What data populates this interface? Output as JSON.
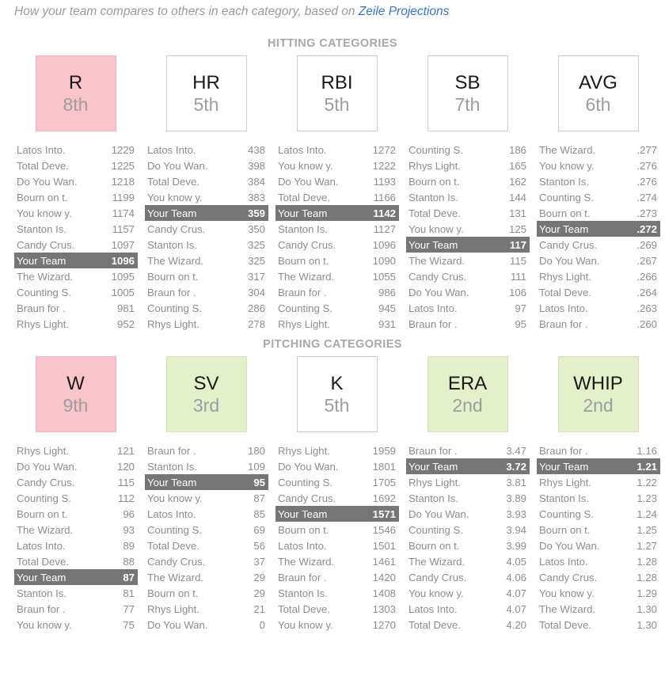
{
  "intro": {
    "text_before": "How your team compares to others in each category, based on ",
    "link_text": "Zeile Projections"
  },
  "colors": {
    "highlight_row": "#767676",
    "bad_box": "#fbc3ca",
    "good_box": "#e3f0c9",
    "link": "#3b73c4",
    "muted_text": "#8d8d8d"
  },
  "sections": [
    {
      "title": "HITTING CATEGORIES",
      "columns": [
        {
          "abbr": "R",
          "rank": "8th",
          "style": "pink",
          "rows": [
            {
              "team": "Latos Into.",
              "value": "1229",
              "me": false
            },
            {
              "team": "Total Deve.",
              "value": "1225",
              "me": false
            },
            {
              "team": "Do You Wan.",
              "value": "1218",
              "me": false
            },
            {
              "team": "Bourn on t.",
              "value": "1199",
              "me": false
            },
            {
              "team": "You know y.",
              "value": "1174",
              "me": false
            },
            {
              "team": "Stanton Is.",
              "value": "1157",
              "me": false
            },
            {
              "team": "Candy Crus.",
              "value": "1097",
              "me": false
            },
            {
              "team": "Your Team",
              "value": "1096",
              "me": true
            },
            {
              "team": "The Wizard.",
              "value": "1095",
              "me": false
            },
            {
              "team": "Counting S.",
              "value": "1005",
              "me": false
            },
            {
              "team": "Braun for .",
              "value": "981",
              "me": false
            },
            {
              "team": "Rhys Light.",
              "value": "952",
              "me": false
            }
          ]
        },
        {
          "abbr": "HR",
          "rank": "5th",
          "style": "plain",
          "rows": [
            {
              "team": "Latos Into.",
              "value": "438",
              "me": false
            },
            {
              "team": "Do You Wan.",
              "value": "398",
              "me": false
            },
            {
              "team": "Total Deve.",
              "value": "384",
              "me": false
            },
            {
              "team": "You know y.",
              "value": "383",
              "me": false
            },
            {
              "team": "Your Team",
              "value": "359",
              "me": true
            },
            {
              "team": "Candy Crus.",
              "value": "350",
              "me": false
            },
            {
              "team": "Stanton Is.",
              "value": "325",
              "me": false
            },
            {
              "team": "The Wizard.",
              "value": "325",
              "me": false
            },
            {
              "team": "Bourn on t.",
              "value": "317",
              "me": false
            },
            {
              "team": "Braun for .",
              "value": "304",
              "me": false
            },
            {
              "team": "Counting S.",
              "value": "286",
              "me": false
            },
            {
              "team": "Rhys Light.",
              "value": "278",
              "me": false
            }
          ]
        },
        {
          "abbr": "RBI",
          "rank": "5th",
          "style": "plain",
          "rows": [
            {
              "team": "Latos Into.",
              "value": "1272",
              "me": false
            },
            {
              "team": "You know y.",
              "value": "1222",
              "me": false
            },
            {
              "team": "Do You Wan.",
              "value": "1193",
              "me": false
            },
            {
              "team": "Total Deve.",
              "value": "1166",
              "me": false
            },
            {
              "team": "Your Team",
              "value": "1142",
              "me": true
            },
            {
              "team": "Stanton Is.",
              "value": "1127",
              "me": false
            },
            {
              "team": "Candy Crus.",
              "value": "1096",
              "me": false
            },
            {
              "team": "Bourn on t.",
              "value": "1090",
              "me": false
            },
            {
              "team": "The Wizard.",
              "value": "1055",
              "me": false
            },
            {
              "team": "Braun for .",
              "value": "986",
              "me": false
            },
            {
              "team": "Counting S.",
              "value": "945",
              "me": false
            },
            {
              "team": "Rhys Light.",
              "value": "931",
              "me": false
            }
          ]
        },
        {
          "abbr": "SB",
          "rank": "7th",
          "style": "plain",
          "rows": [
            {
              "team": "Counting S.",
              "value": "186",
              "me": false
            },
            {
              "team": "Rhys Light.",
              "value": "165",
              "me": false
            },
            {
              "team": "Bourn on t.",
              "value": "162",
              "me": false
            },
            {
              "team": "Stanton Is.",
              "value": "144",
              "me": false
            },
            {
              "team": "Total Deve.",
              "value": "131",
              "me": false
            },
            {
              "team": "You know y.",
              "value": "125",
              "me": false
            },
            {
              "team": "Your Team",
              "value": "117",
              "me": true
            },
            {
              "team": "The Wizard.",
              "value": "115",
              "me": false
            },
            {
              "team": "Candy Crus.",
              "value": "111",
              "me": false
            },
            {
              "team": "Do You Wan.",
              "value": "106",
              "me": false
            },
            {
              "team": "Latos Into.",
              "value": "97",
              "me": false
            },
            {
              "team": "Braun for .",
              "value": "95",
              "me": false
            }
          ]
        },
        {
          "abbr": "AVG",
          "rank": "6th",
          "style": "plain",
          "rows": [
            {
              "team": "The Wizard.",
              "value": ".277",
              "me": false
            },
            {
              "team": "You know y.",
              "value": ".276",
              "me": false
            },
            {
              "team": "Stanton Is.",
              "value": ".276",
              "me": false
            },
            {
              "team": "Counting S.",
              "value": ".274",
              "me": false
            },
            {
              "team": "Bourn on t.",
              "value": ".273",
              "me": false
            },
            {
              "team": "Your Team",
              "value": ".272",
              "me": true
            },
            {
              "team": "Candy Crus.",
              "value": ".269",
              "me": false
            },
            {
              "team": "Do You Wan.",
              "value": ".267",
              "me": false
            },
            {
              "team": "Rhys Light.",
              "value": ".266",
              "me": false
            },
            {
              "team": "Total Deve.",
              "value": ".264",
              "me": false
            },
            {
              "team": "Latos Into.",
              "value": ".263",
              "me": false
            },
            {
              "team": "Braun for .",
              "value": ".260",
              "me": false
            }
          ]
        }
      ]
    },
    {
      "title": "PITCHING CATEGORIES",
      "columns": [
        {
          "abbr": "W",
          "rank": "9th",
          "style": "pink",
          "rows": [
            {
              "team": "Rhys Light.",
              "value": "121",
              "me": false
            },
            {
              "team": "Do You Wan.",
              "value": "120",
              "me": false
            },
            {
              "team": "Candy Crus.",
              "value": "115",
              "me": false
            },
            {
              "team": "Counting S.",
              "value": "112",
              "me": false
            },
            {
              "team": "Bourn on t.",
              "value": "96",
              "me": false
            },
            {
              "team": "The Wizard.",
              "value": "93",
              "me": false
            },
            {
              "team": "Latos Into.",
              "value": "89",
              "me": false
            },
            {
              "team": "Total Deve.",
              "value": "88",
              "me": false
            },
            {
              "team": "Your Team",
              "value": "87",
              "me": true
            },
            {
              "team": "Stanton Is.",
              "value": "81",
              "me": false
            },
            {
              "team": "Braun for .",
              "value": "77",
              "me": false
            },
            {
              "team": "You know y.",
              "value": "75",
              "me": false
            }
          ]
        },
        {
          "abbr": "SV",
          "rank": "3rd",
          "style": "green",
          "rows": [
            {
              "team": "Braun for .",
              "value": "180",
              "me": false
            },
            {
              "team": "Stanton Is.",
              "value": "109",
              "me": false
            },
            {
              "team": "Your Team",
              "value": "95",
              "me": true
            },
            {
              "team": "You know y.",
              "value": "87",
              "me": false
            },
            {
              "team": "Latos Into.",
              "value": "85",
              "me": false
            },
            {
              "team": "Counting S.",
              "value": "69",
              "me": false
            },
            {
              "team": "Total Deve.",
              "value": "56",
              "me": false
            },
            {
              "team": "Candy Crus.",
              "value": "37",
              "me": false
            },
            {
              "team": "The Wizard.",
              "value": "29",
              "me": false
            },
            {
              "team": "Bourn on t.",
              "value": "29",
              "me": false
            },
            {
              "team": "Rhys Light.",
              "value": "21",
              "me": false
            },
            {
              "team": "Do You Wan.",
              "value": "0",
              "me": false
            }
          ]
        },
        {
          "abbr": "K",
          "rank": "5th",
          "style": "plain",
          "rows": [
            {
              "team": "Rhys Light.",
              "value": "1959",
              "me": false
            },
            {
              "team": "Do You Wan.",
              "value": "1801",
              "me": false
            },
            {
              "team": "Counting S.",
              "value": "1705",
              "me": false
            },
            {
              "team": "Candy Crus.",
              "value": "1692",
              "me": false
            },
            {
              "team": "Your Team",
              "value": "1571",
              "me": true
            },
            {
              "team": "Bourn on t.",
              "value": "1546",
              "me": false
            },
            {
              "team": "Latos Into.",
              "value": "1501",
              "me": false
            },
            {
              "team": "The Wizard.",
              "value": "1461",
              "me": false
            },
            {
              "team": "Braun for .",
              "value": "1420",
              "me": false
            },
            {
              "team": "Stanton Is.",
              "value": "1408",
              "me": false
            },
            {
              "team": "Total Deve.",
              "value": "1303",
              "me": false
            },
            {
              "team": "You know y.",
              "value": "1270",
              "me": false
            }
          ]
        },
        {
          "abbr": "ERA",
          "rank": "2nd",
          "style": "green",
          "rows": [
            {
              "team": "Braun for .",
              "value": "3.47",
              "me": false
            },
            {
              "team": "Your Team",
              "value": "3.72",
              "me": true
            },
            {
              "team": "Rhys Light.",
              "value": "3.81",
              "me": false
            },
            {
              "team": "Stanton Is.",
              "value": "3.89",
              "me": false
            },
            {
              "team": "Do You Wan.",
              "value": "3.93",
              "me": false
            },
            {
              "team": "Counting S.",
              "value": "3.94",
              "me": false
            },
            {
              "team": "Bourn on t.",
              "value": "3.99",
              "me": false
            },
            {
              "team": "The Wizard.",
              "value": "4.05",
              "me": false
            },
            {
              "team": "Candy Crus.",
              "value": "4.06",
              "me": false
            },
            {
              "team": "You know y.",
              "value": "4.07",
              "me": false
            },
            {
              "team": "Latos Into.",
              "value": "4.07",
              "me": false
            },
            {
              "team": "Total Deve.",
              "value": "4.20",
              "me": false
            }
          ]
        },
        {
          "abbr": "WHIP",
          "rank": "2nd",
          "style": "green",
          "rows": [
            {
              "team": "Braun for .",
              "value": "1.16",
              "me": false
            },
            {
              "team": "Your Team",
              "value": "1.21",
              "me": true
            },
            {
              "team": "Rhys Light.",
              "value": "1.22",
              "me": false
            },
            {
              "team": "Stanton Is.",
              "value": "1.23",
              "me": false
            },
            {
              "team": "Counting S.",
              "value": "1.24",
              "me": false
            },
            {
              "team": "Bourn on t.",
              "value": "1.25",
              "me": false
            },
            {
              "team": "Do You Wan.",
              "value": "1.27",
              "me": false
            },
            {
              "team": "Latos Into.",
              "value": "1.28",
              "me": false
            },
            {
              "team": "Candy Crus.",
              "value": "1.28",
              "me": false
            },
            {
              "team": "You know y.",
              "value": "1.29",
              "me": false
            },
            {
              "team": "The Wizard.",
              "value": "1.30",
              "me": false
            },
            {
              "team": "Total Deve.",
              "value": "1.30",
              "me": false
            }
          ]
        }
      ]
    }
  ]
}
